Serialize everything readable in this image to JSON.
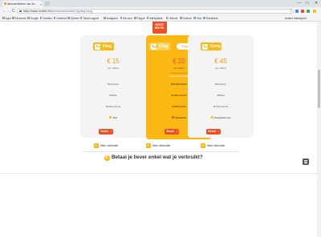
{
  "browser": {
    "tab_title": "Abonnementen van Ja...",
    "tab_close": "×",
    "window_controls": [
      "—",
      "□",
      "✕"
    ],
    "nav": {
      "back": "←",
      "forward": "→",
      "reload": "C"
    },
    "url_domain": "https://www.mobiel.nl/",
    "url_path": "abonnement/mobiel-4g-king-kong",
    "bookmarks": [
      "Apps",
      "Facebook",
      "Google",
      "Gmailen",
      "Omnibox",
      "Openen",
      "Ticket support",
      "Instagram",
      "Bol.com",
      "Paypal",
      "Marktplaats",
      "Hotmail",
      "Outlook",
      "Vind",
      "Rabobank"
    ],
    "other_bookmarks": "Andere bladwijzers",
    "ext_colors": [
      "#4285f4",
      "#ea4335",
      "#34a853",
      "#fbbc05"
    ]
  },
  "brand": {
    "line1": "MEEST",
    "line2": "BESTEL"
  },
  "plans": [
    {
      "name": "Ding",
      "price": "€ 15",
      "price_sub": "per maand",
      "features": [
        {
          "text": "Belminuten"
        },
        {
          "text": "SMSjes"
        },
        {
          "text": "Mobiel internet"
        },
        {
          "text": "Veel",
          "strong": true,
          "icon_color": "#fcb812"
        }
      ],
      "button": "Bestel",
      "more": "Meer informatie"
    },
    {
      "name": "King",
      "pill": "Populairste",
      "price": "€ 20",
      "price_sub": "per maand",
      "promo_old": "nu 1e maand €10",
      "promo_new": "eerste maand gratis",
      "features": [
        {
          "text": "250 belminuten",
          "strong": true
        },
        {
          "text": "10.000 sms'jes",
          "strong": true
        },
        {
          "text": "2 GB internet",
          "strong": true
        },
        {
          "text": "Onbeperkt",
          "strong": true,
          "icon_color": "#f04e23"
        }
      ],
      "button": "Bestel",
      "more": "Meer informatie"
    },
    {
      "name": "Kong",
      "price": "€ 45",
      "price_sub": "per maand",
      "features": [
        {
          "text": "Belminuten"
        },
        {
          "text": "SMSjes"
        },
        {
          "text": "Mobiel internet"
        },
        {
          "text": "Onbeperkt veel",
          "strong": true,
          "icon_color": "#fcb812"
        }
      ],
      "button": "Bestel",
      "more": "Meer informatie"
    }
  ],
  "button_arrow": "›",
  "more_plus": "+",
  "question": "Betaal je liever enkel wat je verbruikt?",
  "question_icon": "€"
}
